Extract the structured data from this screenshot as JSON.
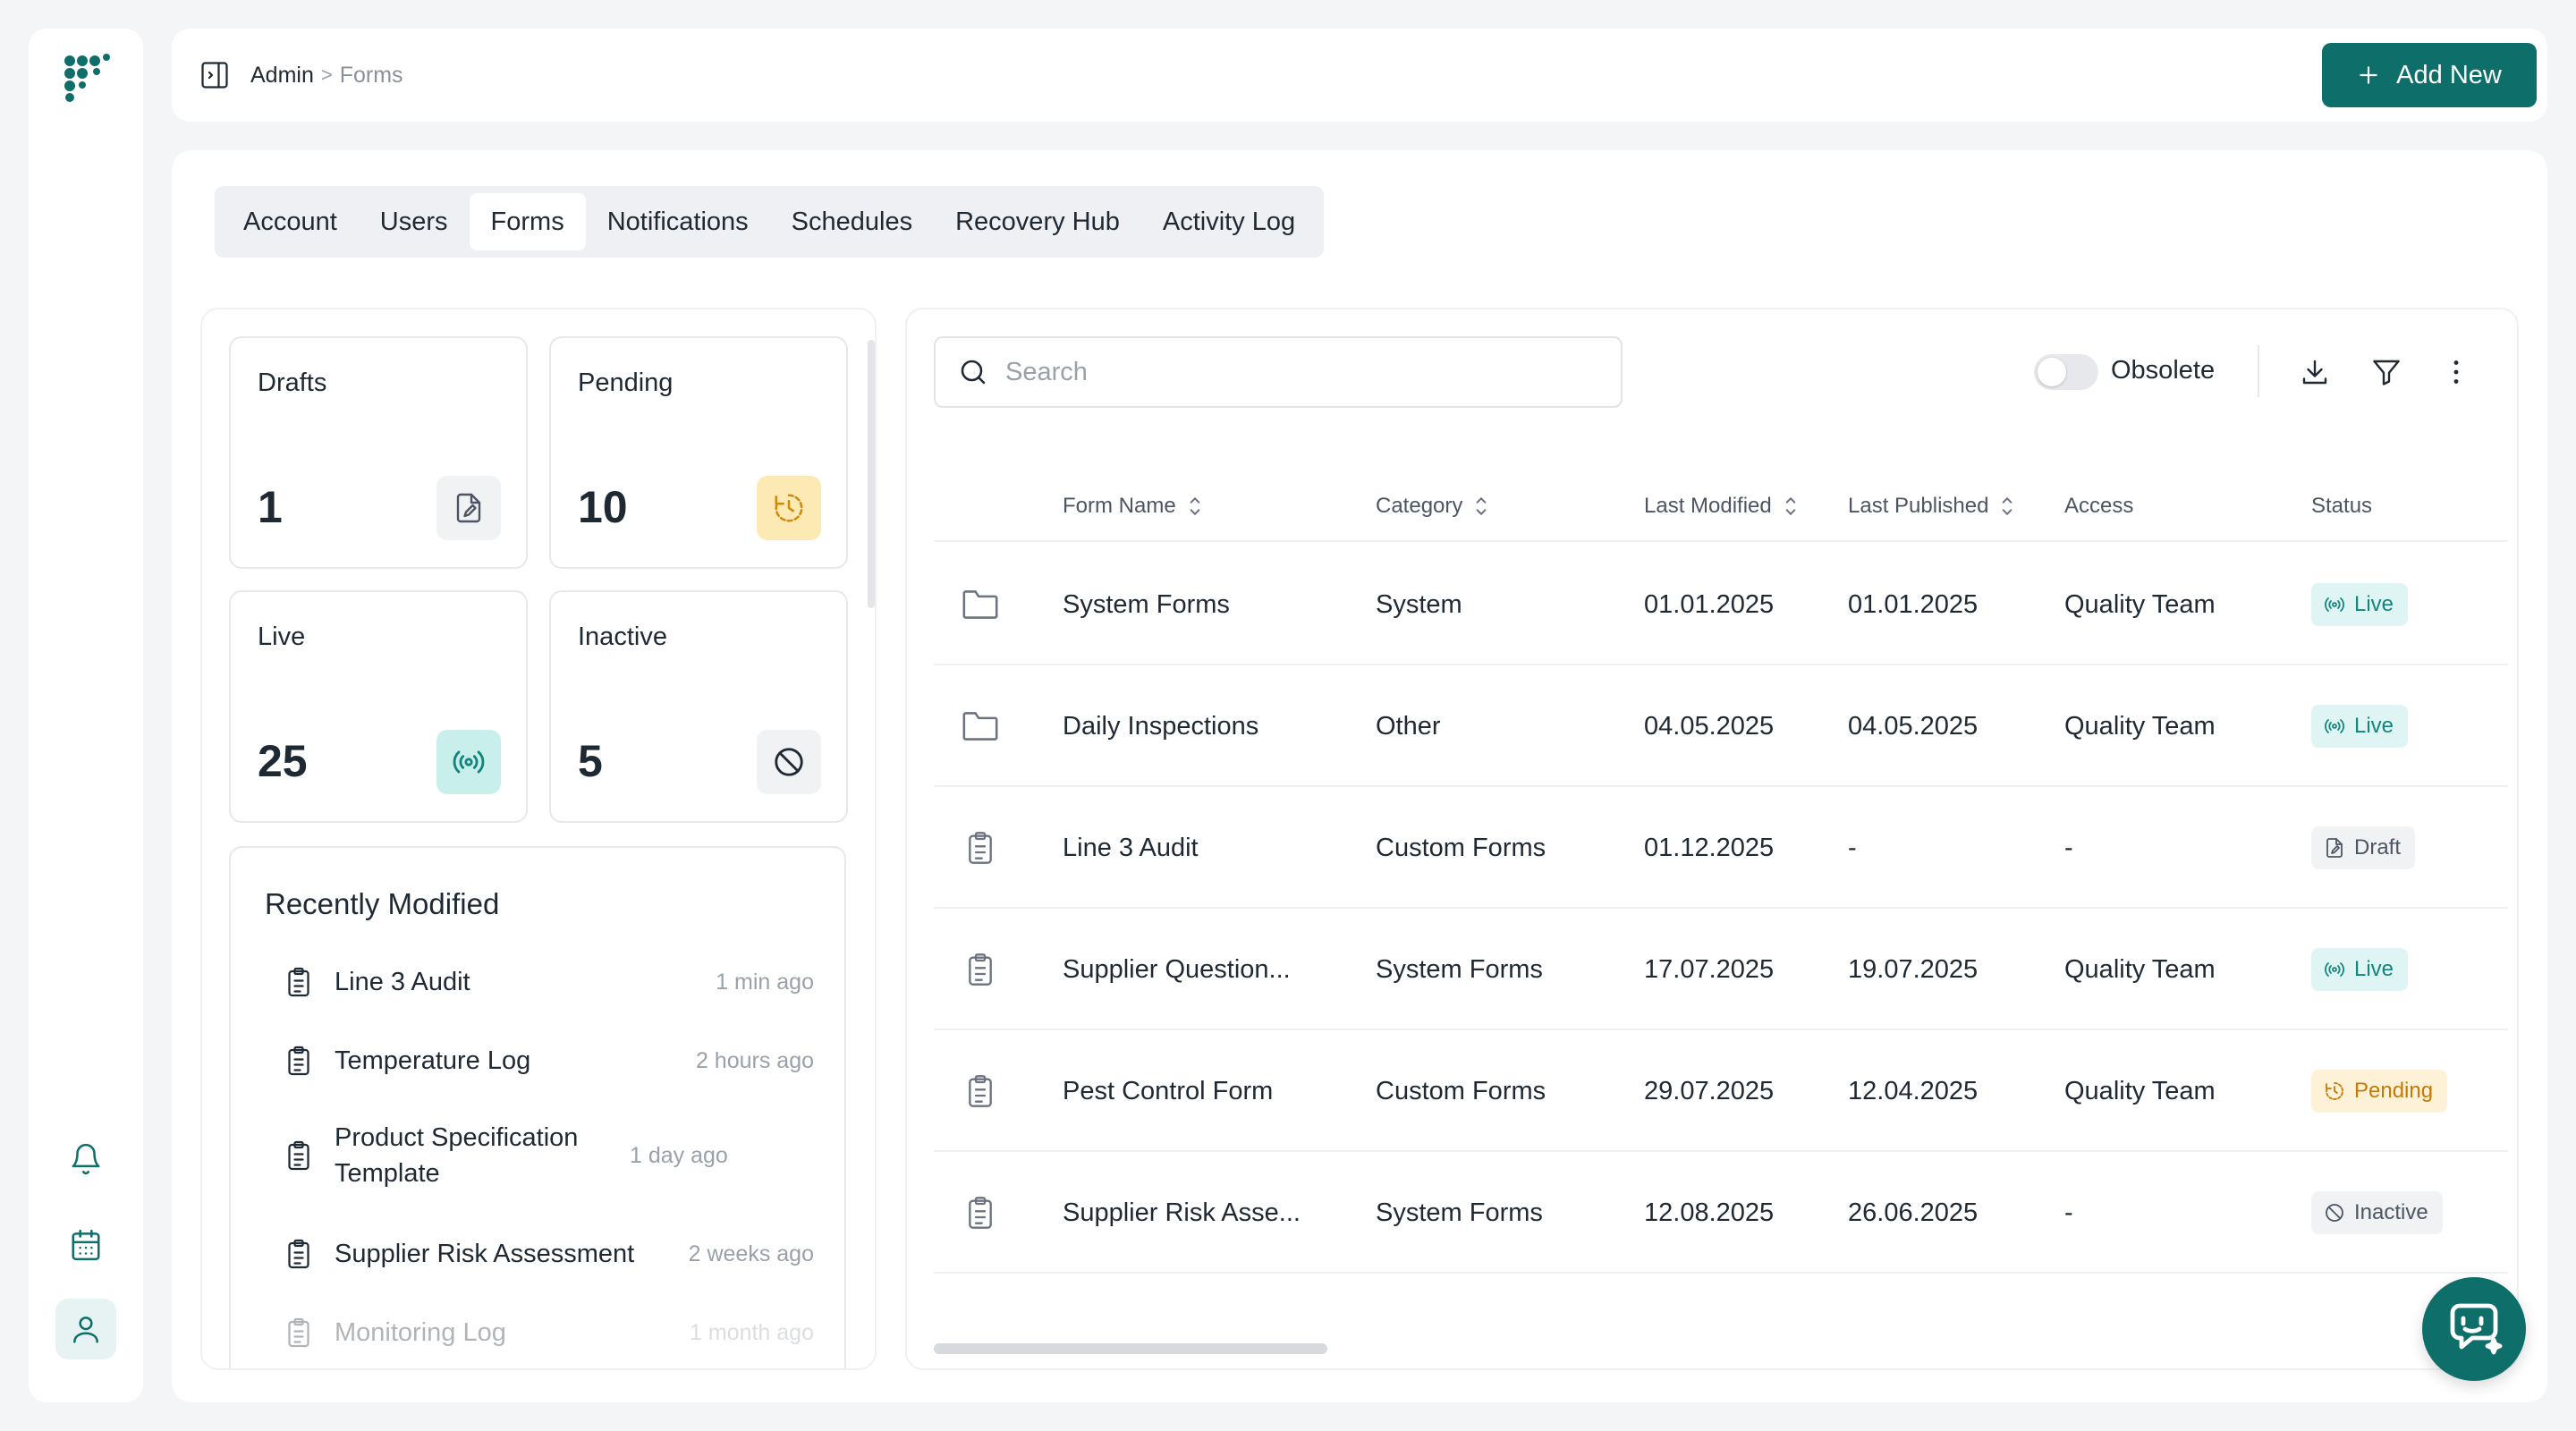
{
  "breadcrumb": {
    "root": "Admin",
    "separator": ">",
    "current": "Forms"
  },
  "header": {
    "add_new_label": "Add New"
  },
  "tabs": [
    {
      "label": "Account"
    },
    {
      "label": "Users"
    },
    {
      "label": "Forms",
      "active": true
    },
    {
      "label": "Notifications"
    },
    {
      "label": "Schedules"
    },
    {
      "label": "Recovery Hub"
    },
    {
      "label": "Activity Log"
    }
  ],
  "stats": {
    "drafts": {
      "label": "Drafts",
      "value": "1",
      "icon": "draft-file-icon"
    },
    "pending": {
      "label": "Pending",
      "value": "10",
      "icon": "clock-icon"
    },
    "live": {
      "label": "Live",
      "value": "25",
      "icon": "broadcast-icon"
    },
    "inactive": {
      "label": "Inactive",
      "value": "5",
      "icon": "ban-icon"
    }
  },
  "recent": {
    "title": "Recently Modified",
    "items": [
      {
        "name": "Line 3 Audit",
        "time": "1 min ago"
      },
      {
        "name": "Temperature Log",
        "time": "2 hours ago"
      },
      {
        "name": "Product Specification Template",
        "time": "1 day ago"
      },
      {
        "name": "Supplier Risk Assessment",
        "time": "2 weeks ago"
      },
      {
        "name": "Monitoring Log",
        "time": "1 month ago"
      }
    ]
  },
  "toolbar": {
    "search_placeholder": "Search",
    "obsolete_label": "Obsolete",
    "obsolete_on": false
  },
  "table": {
    "columns": [
      "Form Name",
      "Category",
      "Last Modified",
      "Last Published",
      "Access",
      "Status"
    ],
    "rows": [
      {
        "type": "folder",
        "name": "System Forms",
        "category": "System",
        "modified": "01.01.2025",
        "published": "01.01.2025",
        "access": "Quality Team",
        "status": "Live"
      },
      {
        "type": "folder",
        "name": "Daily Inspections",
        "category": "Other",
        "modified": "04.05.2025",
        "published": "04.05.2025",
        "access": "Quality Team",
        "status": "Live"
      },
      {
        "type": "form",
        "name": "Line 3 Audit",
        "category": "Custom Forms",
        "modified": "01.12.2025",
        "published": "-",
        "access": "-",
        "status": "Draft"
      },
      {
        "type": "form",
        "name": "Supplier Question...",
        "category": "System Forms",
        "modified": "17.07.2025",
        "published": "19.07.2025",
        "access": "Quality Team",
        "status": "Live"
      },
      {
        "type": "form",
        "name": "Pest Control Form",
        "category": "Custom Forms",
        "modified": "29.07.2025",
        "published": "12.04.2025",
        "access": "Quality Team",
        "status": "Pending"
      },
      {
        "type": "form",
        "name": "Supplier Risk Asse...",
        "category": "System Forms",
        "modified": "12.08.2025",
        "published": "26.06.2025",
        "access": "-",
        "status": "Inactive"
      }
    ]
  },
  "colors": {
    "brand": "#0e6f6a",
    "live": "#13857c",
    "pending": "#c47a05",
    "muted": "#9aa1aa"
  }
}
